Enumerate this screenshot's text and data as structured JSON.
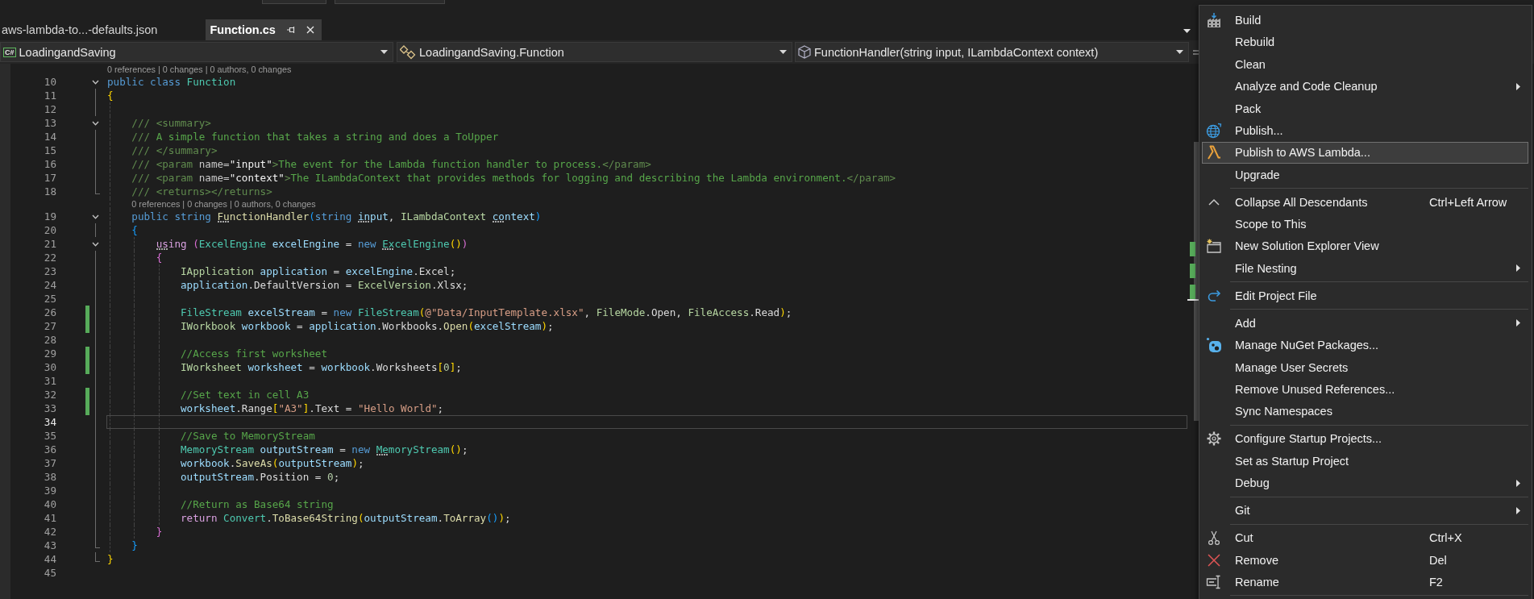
{
  "tabs": [
    {
      "label": "aws-lambda-to...-defaults.json",
      "selected": false
    },
    {
      "label": "Function.cs",
      "selected": true
    }
  ],
  "navigation_bar": {
    "project": {
      "badge": "C#",
      "label": "LoadingandSaving"
    },
    "type": {
      "label": "LoadingandSaving.Function"
    },
    "member": {
      "label": "FunctionHandler(string input, ILambdaContext context)"
    }
  },
  "code": {
    "lines": [
      {
        "number": "10",
        "codelens": "0 references | 0 changes | 0 authors, 0 changes",
        "tokens": [
          {
            "kind": "keyword",
            "text": "public class "
          },
          {
            "kind": "type",
            "text": "Function"
          }
        ],
        "kind": "opener",
        "changed": false,
        "current": false
      },
      {
        "number": "11",
        "tokens": [
          {
            "kind": "bracket1",
            "text": "{"
          }
        ],
        "kind": "body",
        "changed": false,
        "current": false
      },
      {
        "number": "12",
        "kind": "body",
        "changed": false,
        "current": false
      },
      {
        "number": "13",
        "tokens": [
          {
            "kind": "doc",
            "text": "    /// <summary>"
          }
        ],
        "kind": "opener",
        "changed": false,
        "current": false
      },
      {
        "number": "14",
        "tokens": [
          {
            "kind": "doc",
            "text": "    ///"
          },
          {
            "kind": "comment",
            "text": " A simple function that takes a string and does a ToUpper"
          }
        ],
        "kind": "body",
        "changed": false,
        "current": false
      },
      {
        "number": "15",
        "tokens": [
          {
            "kind": "doc",
            "text": "    /// </summary>"
          }
        ],
        "kind": "body",
        "changed": false,
        "current": false
      },
      {
        "number": "16",
        "tokens": [
          {
            "kind": "doc",
            "text": "    /// <param "
          },
          {
            "kind": "docattr",
            "text": "name="
          },
          {
            "kind": "docvalue",
            "text": "\"input\""
          },
          {
            "kind": "doc",
            "text": ">"
          },
          {
            "kind": "comment",
            "text": "The event for the Lambda function handler to process."
          },
          {
            "kind": "doc",
            "text": "</param>"
          }
        ],
        "kind": "body",
        "changed": false,
        "current": false
      },
      {
        "number": "17",
        "tokens": [
          {
            "kind": "doc",
            "text": "    /// <param "
          },
          {
            "kind": "docattr",
            "text": "name="
          },
          {
            "kind": "docvalue",
            "text": "\"context\""
          },
          {
            "kind": "doc",
            "text": ">"
          },
          {
            "kind": "comment",
            "text": "The ILambdaContext that provides methods for logging and describing the Lambda environment."
          },
          {
            "kind": "doc",
            "text": "</param>"
          }
        ],
        "kind": "body",
        "changed": false,
        "current": false
      },
      {
        "number": "18",
        "tokens": [
          {
            "kind": "doc",
            "text": "    /// <returns></returns>"
          }
        ],
        "kind": "closer",
        "changed": false,
        "current": false
      },
      {
        "number": "19",
        "codelens": "0 references | 0 changes | 0 authors, 0 changes",
        "tokens": [
          {
            "kind": "keyword",
            "text": "    public string "
          },
          {
            "kind": "method",
            "text": "FunctionHandler",
            "hint": true
          },
          {
            "kind": "bracket2",
            "text": "("
          },
          {
            "kind": "keyword",
            "text": "string "
          },
          {
            "kind": "variable",
            "text": "input",
            "hint": true
          },
          {
            "kind": "plain",
            "text": ", "
          },
          {
            "kind": "interface",
            "text": "ILambdaContext "
          },
          {
            "kind": "variable",
            "text": "context",
            "hint": true
          },
          {
            "kind": "bracket2",
            "text": ")"
          }
        ],
        "kind": "opener",
        "changed": false,
        "current": false
      },
      {
        "number": "20",
        "tokens": [
          {
            "kind": "bracket2",
            "text": "    {"
          }
        ],
        "kind": "body",
        "changed": false,
        "current": false
      },
      {
        "number": "21",
        "tokens": [
          {
            "kind": "control",
            "text": "        using ",
            "hint": true
          },
          {
            "kind": "bracket3",
            "text": "("
          },
          {
            "kind": "type",
            "text": "ExcelEngine "
          },
          {
            "kind": "variable",
            "text": "excelEngine"
          },
          {
            "kind": "plain",
            "text": " = "
          },
          {
            "kind": "keyword",
            "text": "new "
          },
          {
            "kind": "type",
            "text": "ExcelEngine",
            "hint": true
          },
          {
            "kind": "bracket1",
            "text": "()"
          },
          {
            "kind": "bracket3",
            "text": ")"
          }
        ],
        "kind": "opener",
        "changed": false,
        "current": false
      },
      {
        "number": "22",
        "tokens": [
          {
            "kind": "bracket3",
            "text": "        {"
          }
        ],
        "kind": "body",
        "changed": false,
        "current": false
      },
      {
        "number": "23",
        "tokens": [
          {
            "kind": "interface",
            "text": "            IApplication "
          },
          {
            "kind": "variable",
            "text": "application"
          },
          {
            "kind": "plain",
            "text": " = "
          },
          {
            "kind": "variable",
            "text": "excelEngine"
          },
          {
            "kind": "plain",
            "text": ".Excel;"
          }
        ],
        "kind": "body",
        "changed": false,
        "current": false
      },
      {
        "number": "24",
        "tokens": [
          {
            "kind": "variable",
            "text": "            application"
          },
          {
            "kind": "plain",
            "text": ".DefaultVersion = "
          },
          {
            "kind": "enum",
            "text": "ExcelVersion"
          },
          {
            "kind": "plain",
            "text": ".Xlsx;"
          }
        ],
        "kind": "body",
        "changed": false,
        "current": false
      },
      {
        "number": "25",
        "kind": "body",
        "changed": false,
        "current": false
      },
      {
        "number": "26",
        "tokens": [
          {
            "kind": "type",
            "text": "            FileStream "
          },
          {
            "kind": "variable",
            "text": "excelStream"
          },
          {
            "kind": "plain",
            "text": " = "
          },
          {
            "kind": "keyword",
            "text": "new "
          },
          {
            "kind": "type",
            "text": "FileStream"
          },
          {
            "kind": "bracket1",
            "text": "("
          },
          {
            "kind": "string",
            "text": "@\"Data/InputTemplate.xlsx\""
          },
          {
            "kind": "plain",
            "text": ", "
          },
          {
            "kind": "enum",
            "text": "FileMode"
          },
          {
            "kind": "plain",
            "text": ".Open, "
          },
          {
            "kind": "enum",
            "text": "FileAccess"
          },
          {
            "kind": "plain",
            "text": ".Read"
          },
          {
            "kind": "bracket1",
            "text": ")"
          },
          {
            "kind": "plain",
            "text": ";"
          }
        ],
        "kind": "body",
        "changed": true,
        "current": false
      },
      {
        "number": "27",
        "tokens": [
          {
            "kind": "interface",
            "text": "            IWorkbook "
          },
          {
            "kind": "variable",
            "text": "workbook"
          },
          {
            "kind": "plain",
            "text": " = "
          },
          {
            "kind": "variable",
            "text": "application"
          },
          {
            "kind": "plain",
            "text": ".Workbooks."
          },
          {
            "kind": "method",
            "text": "Open"
          },
          {
            "kind": "bracket1",
            "text": "("
          },
          {
            "kind": "variable",
            "text": "excelStream"
          },
          {
            "kind": "bracket1",
            "text": ")"
          },
          {
            "kind": "plain",
            "text": ";"
          }
        ],
        "kind": "body",
        "changed": true,
        "current": false
      },
      {
        "number": "28",
        "kind": "body",
        "changed": false,
        "current": false
      },
      {
        "number": "29",
        "tokens": [
          {
            "kind": "comment",
            "text": "            //Access first worksheet"
          }
        ],
        "kind": "body",
        "changed": true,
        "current": false
      },
      {
        "number": "30",
        "tokens": [
          {
            "kind": "interface",
            "text": "            IWorksheet "
          },
          {
            "kind": "variable",
            "text": "worksheet"
          },
          {
            "kind": "plain",
            "text": " = "
          },
          {
            "kind": "variable",
            "text": "workbook"
          },
          {
            "kind": "plain",
            "text": ".Worksheets"
          },
          {
            "kind": "bracket1",
            "text": "["
          },
          {
            "kind": "number",
            "text": "0"
          },
          {
            "kind": "bracket1",
            "text": "]"
          },
          {
            "kind": "plain",
            "text": ";"
          }
        ],
        "kind": "body",
        "changed": true,
        "current": false
      },
      {
        "number": "31",
        "kind": "body",
        "changed": false,
        "current": false
      },
      {
        "number": "32",
        "tokens": [
          {
            "kind": "comment",
            "text": "            //Set text in cell A3"
          }
        ],
        "kind": "body",
        "changed": true,
        "current": false
      },
      {
        "number": "33",
        "tokens": [
          {
            "kind": "variable",
            "text": "            worksheet"
          },
          {
            "kind": "plain",
            "text": ".Range"
          },
          {
            "kind": "bracket1",
            "text": "["
          },
          {
            "kind": "string",
            "text": "\"A3\""
          },
          {
            "kind": "bracket1",
            "text": "]"
          },
          {
            "kind": "plain",
            "text": ".Text = "
          },
          {
            "kind": "string",
            "text": "\"Hello World\""
          },
          {
            "kind": "plain",
            "text": ";"
          }
        ],
        "kind": "body",
        "changed": true,
        "current": false
      },
      {
        "number": "34",
        "kind": "body",
        "changed": false,
        "current": true
      },
      {
        "number": "35",
        "tokens": [
          {
            "kind": "comment",
            "text": "            //Save to MemoryStream"
          }
        ],
        "kind": "body",
        "changed": false,
        "current": false
      },
      {
        "number": "36",
        "tokens": [
          {
            "kind": "type",
            "text": "            MemoryStream "
          },
          {
            "kind": "variable",
            "text": "outputStream"
          },
          {
            "kind": "plain",
            "text": " = "
          },
          {
            "kind": "keyword",
            "text": "new "
          },
          {
            "kind": "type",
            "text": "MemoryStream",
            "hint": true
          },
          {
            "kind": "bracket1",
            "text": "()"
          },
          {
            "kind": "plain",
            "text": ";"
          }
        ],
        "kind": "body",
        "changed": false,
        "current": false
      },
      {
        "number": "37",
        "tokens": [
          {
            "kind": "variable",
            "text": "            workbook"
          },
          {
            "kind": "plain",
            "text": "."
          },
          {
            "kind": "method",
            "text": "SaveAs"
          },
          {
            "kind": "bracket1",
            "text": "("
          },
          {
            "kind": "variable",
            "text": "outputStream"
          },
          {
            "kind": "bracket1",
            "text": ")"
          },
          {
            "kind": "plain",
            "text": ";"
          }
        ],
        "kind": "body",
        "changed": false,
        "current": false
      },
      {
        "number": "38",
        "tokens": [
          {
            "kind": "variable",
            "text": "            outputStream"
          },
          {
            "kind": "plain",
            "text": ".Position = "
          },
          {
            "kind": "number",
            "text": "0"
          },
          {
            "kind": "plain",
            "text": ";"
          }
        ],
        "kind": "body",
        "changed": false,
        "current": false
      },
      {
        "number": "39",
        "kind": "body",
        "changed": false,
        "current": false
      },
      {
        "number": "40",
        "tokens": [
          {
            "kind": "comment",
            "text": "            //Return as Base64 string"
          }
        ],
        "kind": "body",
        "changed": false,
        "current": false
      },
      {
        "number": "41",
        "tokens": [
          {
            "kind": "control",
            "text": "            return "
          },
          {
            "kind": "type",
            "text": "Convert"
          },
          {
            "kind": "plain",
            "text": "."
          },
          {
            "kind": "method",
            "text": "ToBase64String"
          },
          {
            "kind": "bracket1",
            "text": "("
          },
          {
            "kind": "variable",
            "text": "outputStream"
          },
          {
            "kind": "plain",
            "text": "."
          },
          {
            "kind": "method",
            "text": "ToArray"
          },
          {
            "kind": "bracket2",
            "text": "()"
          },
          {
            "kind": "bracket1",
            "text": ")"
          },
          {
            "kind": "plain",
            "text": ";"
          }
        ],
        "kind": "body",
        "changed": false,
        "current": false
      },
      {
        "number": "42",
        "tokens": [
          {
            "kind": "bracket3",
            "text": "        }"
          }
        ],
        "kind": "body",
        "changed": false,
        "current": false
      },
      {
        "number": "43",
        "tokens": [
          {
            "kind": "bracket2",
            "text": "    }"
          }
        ],
        "kind": "closer",
        "changed": false,
        "current": false
      },
      {
        "number": "44",
        "tokens": [
          {
            "kind": "bracket1",
            "text": "}"
          }
        ],
        "kind": "closer",
        "changed": false,
        "current": false
      },
      {
        "number": "45",
        "kind": "plain",
        "changed": false,
        "current": false
      }
    ]
  },
  "context_menu": {
    "sections": [
      {
        "items": [
          {
            "label": "Build",
            "submenu": false,
            "selected": false
          },
          {
            "label": "Rebuild",
            "submenu": false,
            "selected": false
          },
          {
            "label": "Clean",
            "submenu": false,
            "selected": false
          },
          {
            "label": "Analyze and Code Cleanup",
            "submenu": true,
            "selected": false
          },
          {
            "label": "Pack",
            "submenu": false,
            "selected": false
          },
          {
            "label": "Publish...",
            "submenu": false,
            "selected": false
          },
          {
            "label": "Publish to AWS Lambda...",
            "submenu": false,
            "selected": true
          },
          {
            "label": "Upgrade",
            "submenu": false,
            "selected": false
          }
        ]
      },
      {
        "items": [
          {
            "label": "Collapse All Descendants",
            "shortcut": "Ctrl+Left Arrow",
            "submenu": false,
            "selected": false
          },
          {
            "label": "Scope to This",
            "submenu": false,
            "selected": false
          },
          {
            "label": "New Solution Explorer View",
            "submenu": false,
            "selected": false
          },
          {
            "label": "File Nesting",
            "submenu": true,
            "selected": false
          }
        ]
      },
      {
        "items": [
          {
            "label": "Edit Project File",
            "submenu": false,
            "selected": false
          }
        ]
      },
      {
        "items": [
          {
            "label": "Add",
            "submenu": true,
            "selected": false
          },
          {
            "label": "Manage NuGet Packages...",
            "submenu": false,
            "selected": false
          },
          {
            "label": "Manage User Secrets",
            "submenu": false,
            "selected": false
          },
          {
            "label": "Remove Unused References...",
            "submenu": false,
            "selected": false
          },
          {
            "label": "Sync Namespaces",
            "submenu": false,
            "selected": false
          }
        ]
      },
      {
        "items": [
          {
            "label": "Configure Startup Projects...",
            "submenu": false,
            "selected": false
          },
          {
            "label": "Set as Startup Project",
            "submenu": false,
            "selected": false
          },
          {
            "label": "Debug",
            "submenu": true,
            "selected": false
          }
        ]
      },
      {
        "items": [
          {
            "label": "Git",
            "submenu": true,
            "selected": false
          }
        ]
      },
      {
        "items": [
          {
            "label": "Cut",
            "shortcut": "Ctrl+X",
            "submenu": false,
            "selected": false
          },
          {
            "label": "Remove",
            "shortcut": "Del",
            "submenu": false,
            "selected": false
          },
          {
            "label": "Rename",
            "shortcut": "F2",
            "submenu": false,
            "selected": false
          }
        ]
      }
    ]
  }
}
